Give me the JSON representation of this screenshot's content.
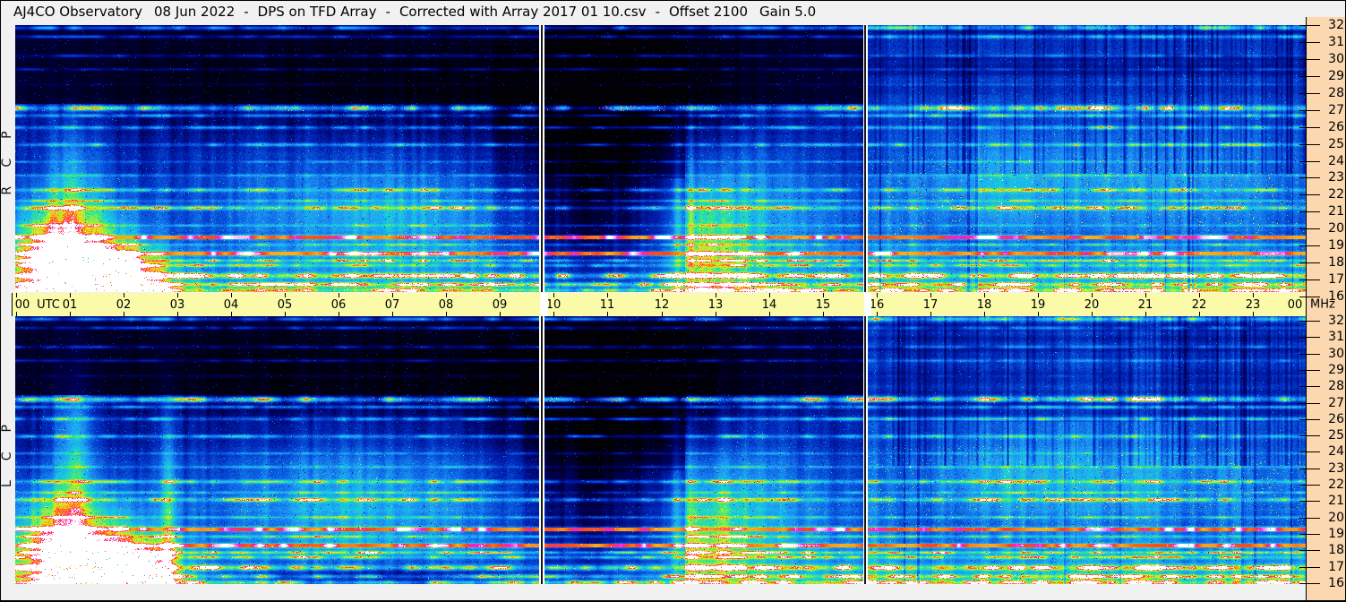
{
  "header": {
    "observatory": "AJ4CO Observatory",
    "date": "08 Jun 2022",
    "separator": "-",
    "instrument": "DPS on TFD Array",
    "correction": "Corrected with Array 2017 01 10.csv",
    "offset": "Offset 2100",
    "gain": "Gain 5.0"
  },
  "panels": [
    {
      "id": "rcp",
      "label": "RCP",
      "description": "right circular polarization spectrogram"
    },
    {
      "id": "lcp",
      "label": "LCP",
      "description": "left circular polarization spectrogram"
    }
  ],
  "time_axis": {
    "utc_label": "UTC",
    "hour_labels": [
      "00",
      "01",
      "02",
      "03",
      "04",
      "05",
      "06",
      "07",
      "08",
      "09",
      "10",
      "11",
      "12",
      "13",
      "14",
      "15",
      "16",
      "17",
      "18",
      "19",
      "20",
      "21",
      "22",
      "23",
      "00"
    ]
  },
  "freq_axis": {
    "unit_label": "MHz",
    "tick_labels": [
      "32",
      "31",
      "30",
      "29",
      "28",
      "27",
      "26",
      "25",
      "24",
      "23",
      "22",
      "21",
      "20",
      "19",
      "18",
      "17",
      "16"
    ]
  },
  "colors": {
    "window_bg": "#f1f1f1",
    "time_axis_bg": "#fafaa8",
    "freq_axis_bg": "#fbd8b0",
    "gap_white": "#ffffff",
    "border": "#000000"
  },
  "chart_data": {
    "type": "heatmap",
    "subtype": "dual-polarization radio spectrogram (dynamic spectrum)",
    "title": "AJ4CO Observatory 08 Jun 2022 - DPS on TFD Array - Corrected with Array 2017 01 10.csv - Offset 2100 Gain 5.0",
    "xlabel": "UTC",
    "ylabel": "MHz",
    "x_range_hours": [
      0,
      24
    ],
    "y_range_mhz": [
      16,
      32
    ],
    "x_ticks": [
      "00",
      "01",
      "02",
      "03",
      "04",
      "05",
      "06",
      "07",
      "08",
      "09",
      "10",
      "11",
      "12",
      "13",
      "14",
      "15",
      "16",
      "17",
      "18",
      "19",
      "20",
      "21",
      "22",
      "23",
      "00"
    ],
    "y_ticks": [
      32,
      31,
      30,
      29,
      28,
      27,
      26,
      25,
      24,
      23,
      22,
      21,
      20,
      19,
      18,
      17,
      16
    ],
    "panels": [
      "RCP",
      "LCP"
    ],
    "data_gaps_utc_hours": [
      [
        9.8,
        10.0
      ],
      [
        15.75,
        15.95
      ]
    ],
    "features": [
      "strong broadband emission 00:30-02:30 UTC below ~24 MHz in both polarizations",
      "diffuse blue enhancement ~04:00-09:00 UTC around 19-24 MHz, brighter in LCP",
      "dark quiet band 10:00-12:30 UTC above ~23 MHz",
      "active speckled green/cyan region 12:30-15:45 UTC at 16-24 MHz",
      "picket-fence interference with dark vertical bands 16:00-24:00 UTC",
      "persistent horizontal RFI lines including bright sporadic band near 27.4 MHz",
      "bright yellow/orange/red ionospheric bands 16-18.5 MHz across the whole day"
    ],
    "render": {
      "freq_top": 32.6,
      "freq_bottom": 15.85,
      "palette": [
        [
          0.0,
          "#000005"
        ],
        [
          0.13,
          "#00005a"
        ],
        [
          0.28,
          "#0022b4"
        ],
        [
          0.42,
          "#0a5ae0"
        ],
        [
          0.55,
          "#1e96f5"
        ],
        [
          0.66,
          "#19c8e6"
        ],
        [
          0.74,
          "#32e68c"
        ],
        [
          0.81,
          "#96f03c"
        ],
        [
          0.865,
          "#e6eb1e"
        ],
        [
          0.91,
          "#ffa014"
        ],
        [
          0.95,
          "#ff4614"
        ],
        [
          0.975,
          "#ff1ec8"
        ],
        [
          1.0,
          "#ffffff"
        ]
      ],
      "dividers": [
        {
          "x": 585,
          "w": 6
        },
        {
          "x": 947,
          "w": 5
        }
      ],
      "rfi_lines": [
        [
          32.45,
          0.1,
          0.5,
          0
        ],
        [
          31.9,
          0.08,
          0.3,
          0
        ],
        [
          30.7,
          0.08,
          0.26,
          0
        ],
        [
          29.85,
          0.07,
          0.22,
          0
        ],
        [
          28.9,
          0.06,
          0.1,
          0
        ],
        [
          27.42,
          0.13,
          0.72,
          1
        ],
        [
          26.95,
          0.08,
          0.38,
          0
        ],
        [
          26.2,
          0.08,
          0.4,
          0
        ],
        [
          25.12,
          0.08,
          0.42,
          0
        ],
        [
          24.05,
          0.06,
          0.22,
          0
        ],
        [
          23.2,
          0.06,
          0.2,
          0
        ],
        [
          22.28,
          0.08,
          0.36,
          0
        ],
        [
          21.6,
          0.06,
          0.26,
          0
        ],
        [
          21.15,
          0.09,
          0.46,
          1
        ],
        [
          20.05,
          0.06,
          0.26,
          0
        ],
        [
          19.32,
          0.1,
          0.5,
          2
        ],
        [
          18.85,
          0.06,
          0.3,
          0
        ],
        [
          18.28,
          0.1,
          0.55,
          2
        ],
        [
          17.85,
          0.07,
          0.45,
          1
        ],
        [
          17.55,
          0.08,
          0.4,
          0
        ],
        [
          16.9,
          0.12,
          0.65,
          1
        ],
        [
          16.35,
          0.1,
          0.55,
          1
        ],
        [
          15.98,
          0.1,
          0.6,
          1
        ]
      ],
      "panels": [
        {
          "id": "rcp",
          "seed": 1137,
          "blobs": [
            [
              1.2,
              17.8,
              0.8,
              2.8,
              0.6
            ],
            [
              1.05,
              23.0,
              0.35,
              3.0,
              0.26
            ],
            [
              2.1,
              16.6,
              0.6,
              1.5,
              0.45
            ],
            [
              0.45,
              18.8,
              0.5,
              2.2,
              0.3
            ],
            [
              5.9,
              20.8,
              2.4,
              3.0,
              0.3
            ],
            [
              7.7,
              20.3,
              1.3,
              2.3,
              0.15
            ],
            [
              13.7,
              19.8,
              1.6,
              2.6,
              0.34
            ],
            [
              12.8,
              18.8,
              0.55,
              2.8,
              0.26
            ],
            [
              13.3,
              23.8,
              1.2,
              2.0,
              0.16
            ],
            [
              12.3,
              21.0,
              0.06,
              5.0,
              0.22
            ],
            [
              12.55,
              22.0,
              0.05,
              5.0,
              0.18
            ],
            [
              20.9,
              22.3,
              2.4,
              2.6,
              0.2
            ],
            [
              18.2,
              22.6,
              1.0,
              2.2,
              0.15
            ],
            [
              11.2,
              28.0,
              1.5,
              4.0,
              -0.3
            ],
            [
              10.8,
              21.0,
              1.0,
              3.5,
              -0.16
            ],
            [
              6.0,
              28.8,
              3.6,
              2.3,
              -0.16
            ]
          ]
        },
        {
          "id": "lcp",
          "seed": 2291,
          "blobs": [
            [
              1.35,
              17.6,
              0.85,
              2.8,
              0.6
            ],
            [
              1.1,
              24.5,
              0.3,
              3.6,
              0.34
            ],
            [
              2.2,
              16.5,
              0.6,
              1.5,
              0.48
            ],
            [
              0.5,
              19.2,
              0.5,
              2.3,
              0.32
            ],
            [
              2.85,
              21.0,
              0.1,
              5.0,
              0.26
            ],
            [
              6.4,
              20.8,
              2.6,
              3.0,
              0.4
            ],
            [
              13.7,
              19.8,
              1.6,
              2.6,
              0.34
            ],
            [
              12.8,
              18.8,
              0.55,
              2.8,
              0.26
            ],
            [
              13.3,
              23.8,
              1.2,
              2.0,
              0.16
            ],
            [
              12.3,
              21.0,
              0.06,
              5.0,
              0.22
            ],
            [
              12.55,
              22.0,
              0.05,
              5.0,
              0.18
            ],
            [
              20.9,
              22.3,
              2.4,
              2.6,
              0.22
            ],
            [
              18.2,
              22.6,
              1.0,
              2.2,
              0.15
            ],
            [
              11.2,
              28.0,
              1.5,
              4.0,
              -0.3
            ],
            [
              10.8,
              21.0,
              1.0,
              3.5,
              -0.16
            ],
            [
              6.0,
              28.8,
              3.6,
              2.3,
              -0.16
            ],
            [
              6.8,
              16.3,
              2.2,
              0.7,
              -0.4
            ]
          ]
        }
      ]
    }
  }
}
